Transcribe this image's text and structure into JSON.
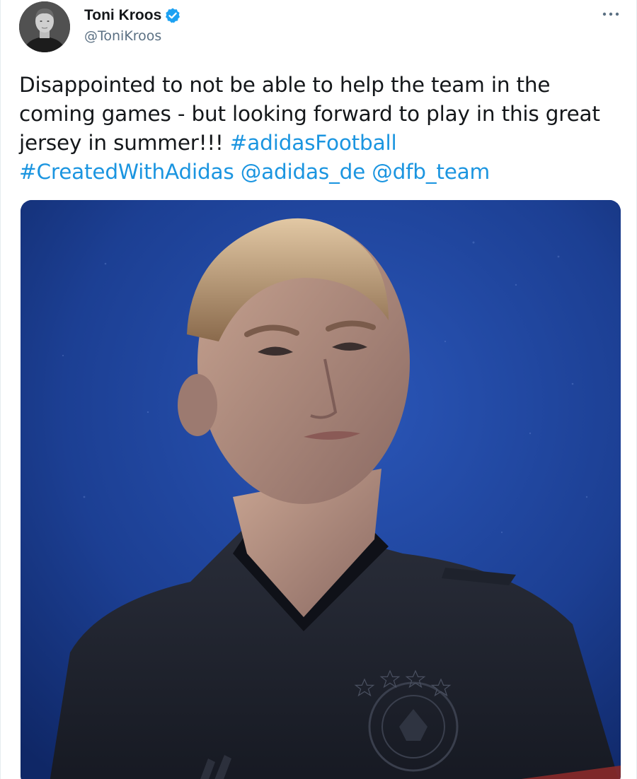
{
  "tweet": {
    "author": {
      "display_name": "Toni Kroos",
      "handle": "@ToniKroos",
      "verified": true,
      "avatar_icon": "profile-photo"
    },
    "more_icon": "more-options-icon",
    "text": {
      "plain_1": "Disappointed to not be able to help the team in the coming games - but looking forward to play in this great jersey in summer!!! ",
      "hashtag_1": "#adidasFootball",
      "hashtag_2": "#CreatedWithAdidas",
      "mention_1": "@adidas_de",
      "mention_2": "@dfb_team"
    },
    "media": {
      "type": "photo",
      "description_icon": "tweet-photo"
    },
    "colors": {
      "link": "#1b95e0",
      "text": "#14171a",
      "secondary": "#5b7083",
      "verified": "#1da1f2",
      "photo_background": "#1a3a8a"
    }
  }
}
